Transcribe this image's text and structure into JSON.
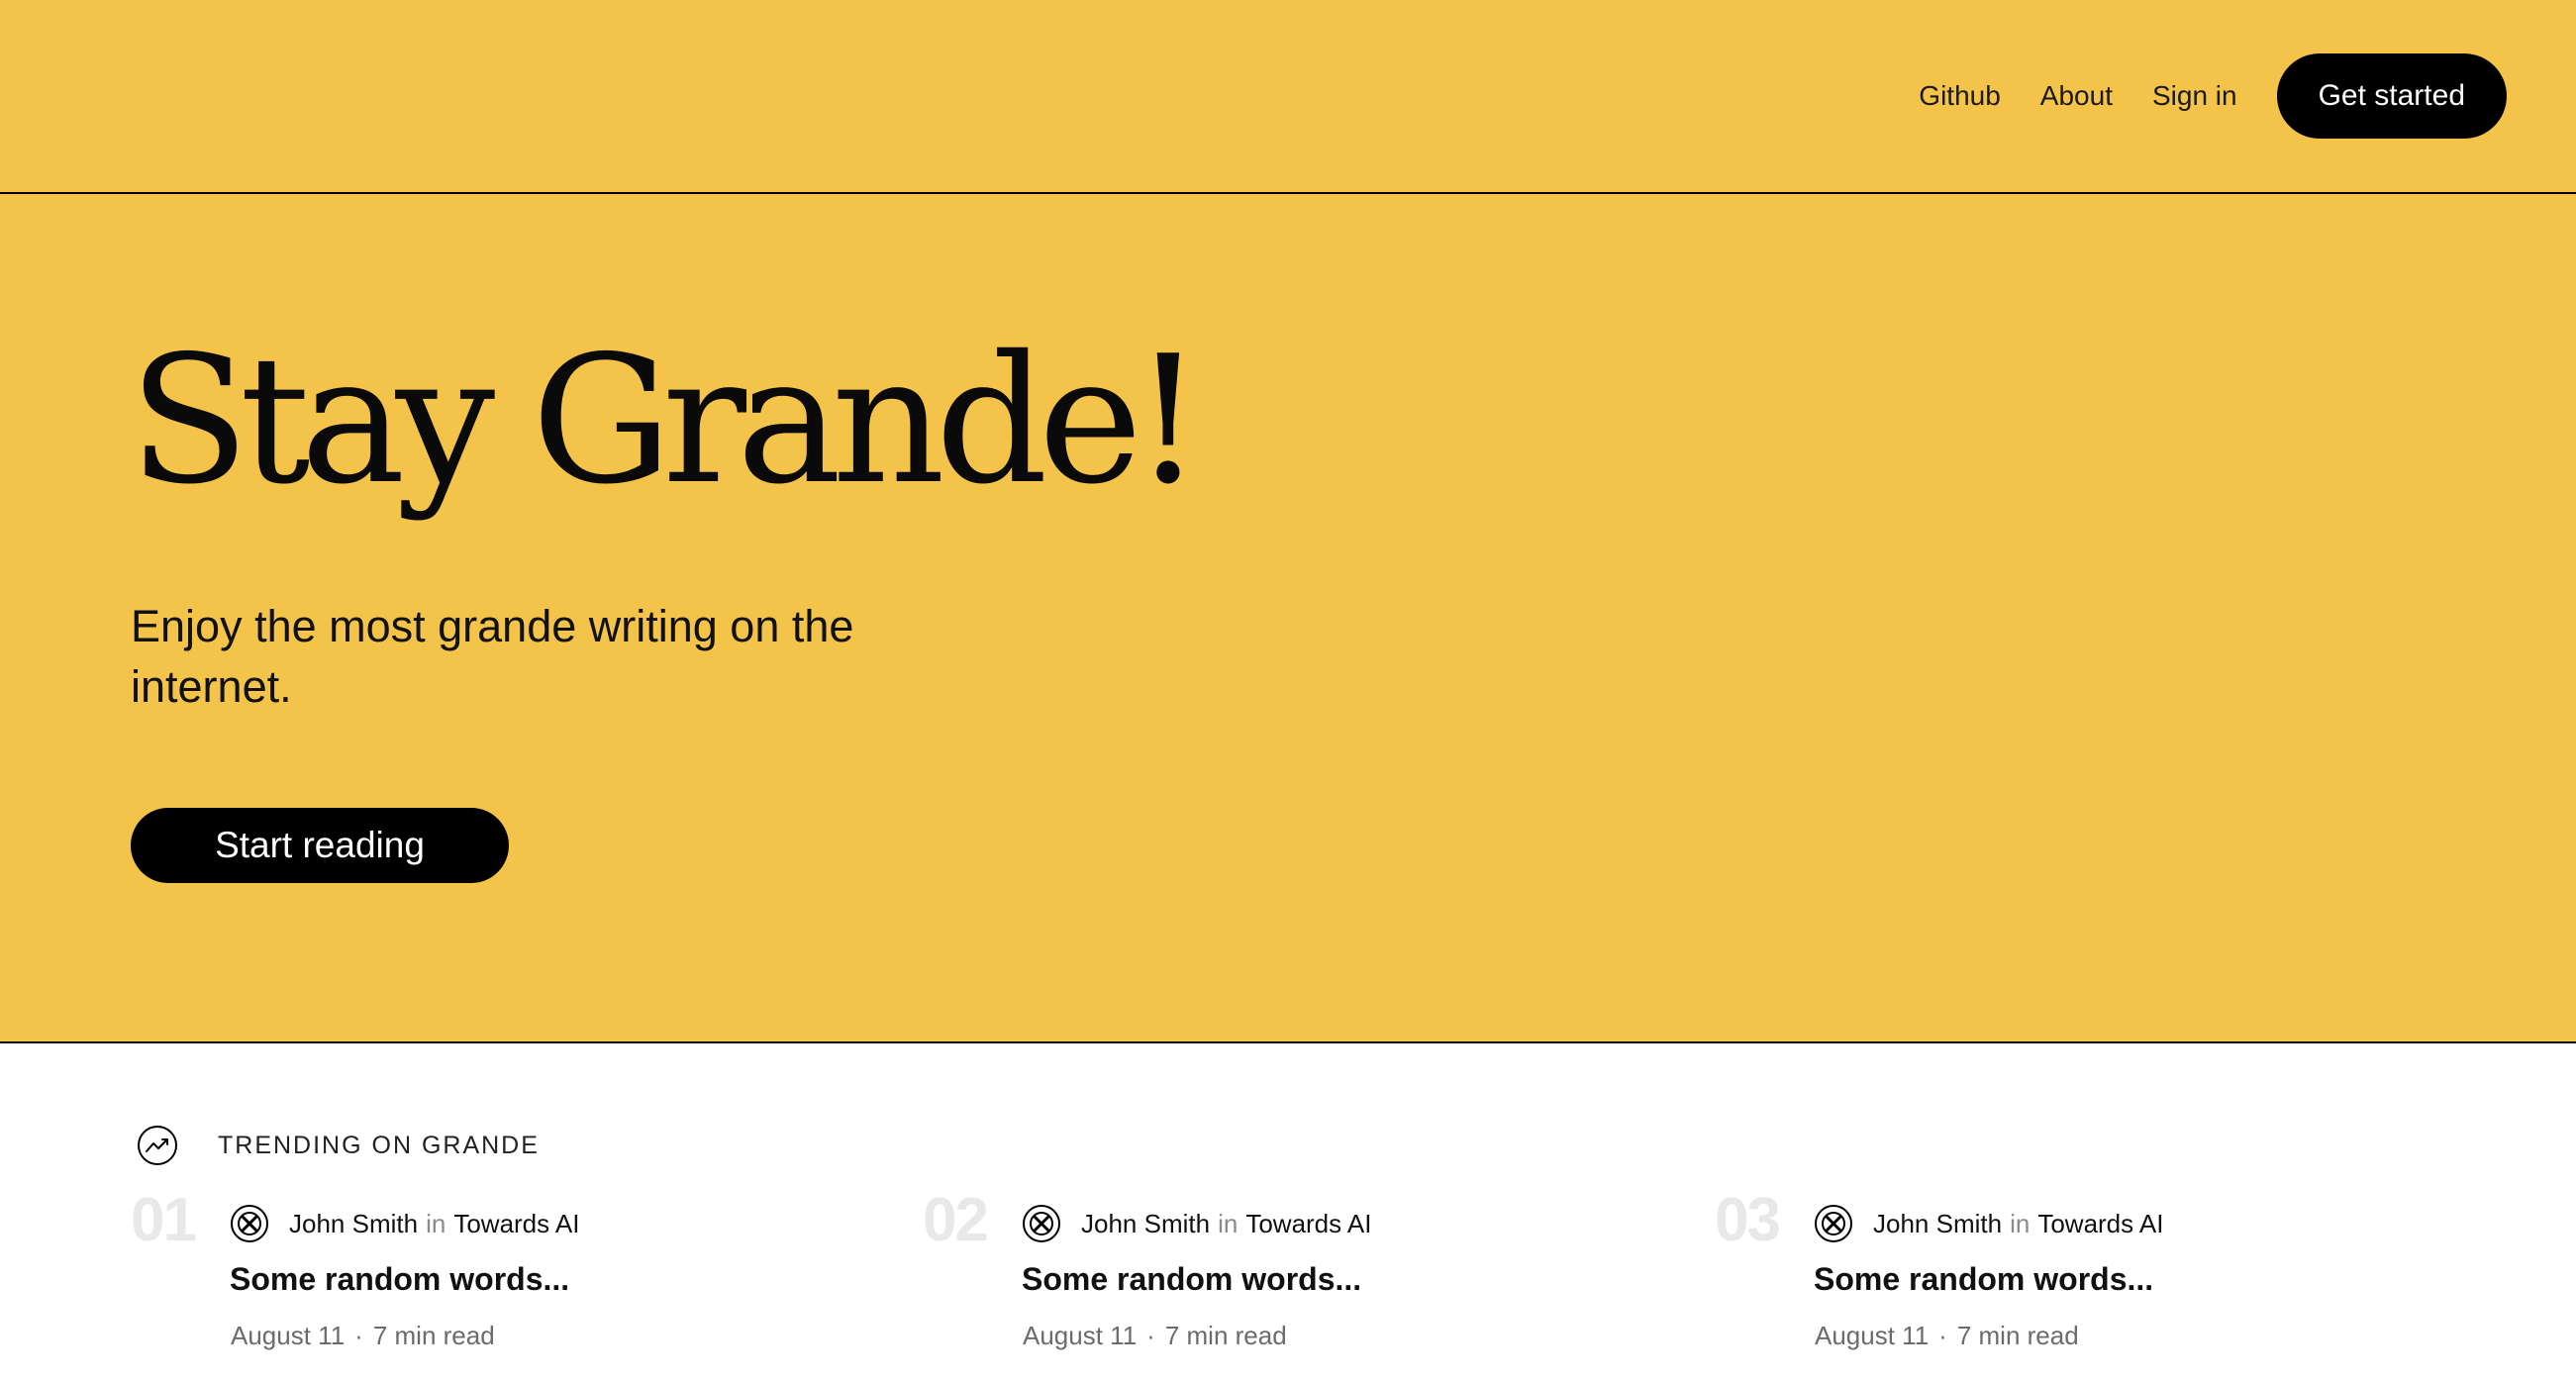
{
  "nav": {
    "links": [
      "Github",
      "About",
      "Sign in"
    ],
    "cta": "Get started"
  },
  "hero": {
    "title": "Stay Grande!",
    "subtitle": "Enjoy the most grande writing on the internet.",
    "cta": "Start reading"
  },
  "trending": {
    "label": "TRENDING ON GRANDE",
    "icon": "trending-up-icon",
    "items": [
      {
        "number": "01",
        "author": "John Smith",
        "in": "in",
        "publication": "Towards AI",
        "title": "Some random words...",
        "date": "August 11",
        "separator": "·",
        "read_time": "7 min read"
      },
      {
        "number": "02",
        "author": "John Smith",
        "in": "in",
        "publication": "Towards AI",
        "title": "Some random words...",
        "date": "August 11",
        "separator": "·",
        "read_time": "7 min read"
      },
      {
        "number": "03",
        "author": "John Smith",
        "in": "in",
        "publication": "Towards AI",
        "title": "Some random words...",
        "date": "August 11",
        "separator": "·",
        "read_time": "7 min read"
      }
    ]
  },
  "colors": {
    "background_accent": "#f4c34a",
    "button": "#000000",
    "trend_number": "#e8e8e8",
    "meta_text": "#6b6b6b"
  }
}
